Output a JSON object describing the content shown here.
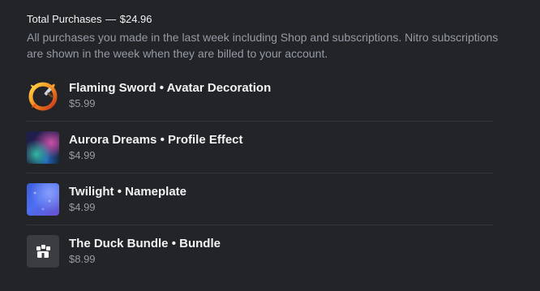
{
  "header": {
    "label": "Total Purchases",
    "separator": "—",
    "total": "$24.96"
  },
  "description": "All purchases you made in the last week including Shop and subscriptions. Nitro subscriptions are shown in the week when they are billed to your account.",
  "purchases": [
    {
      "name": "Flaming Sword",
      "dot": "•",
      "type": "Avatar Decoration",
      "price": "$5.99",
      "icon": "flaming-sword-decoration-icon"
    },
    {
      "name": "Aurora Dreams",
      "dot": "•",
      "type": "Profile Effect",
      "price": "$4.99",
      "icon": "aurora-profile-effect-thumbnail"
    },
    {
      "name": "Twilight",
      "dot": "•",
      "type": "Nameplate",
      "price": "$4.99",
      "icon": "twilight-nameplate-thumbnail"
    },
    {
      "name": "The Duck Bundle",
      "dot": "•",
      "type": "Bundle",
      "price": "$8.99",
      "icon": "bundle-icon"
    }
  ],
  "colors": {
    "background": "#232428",
    "divider": "#34363c",
    "text_primary": "#f2f3f5",
    "text_muted": "#949ba4"
  }
}
